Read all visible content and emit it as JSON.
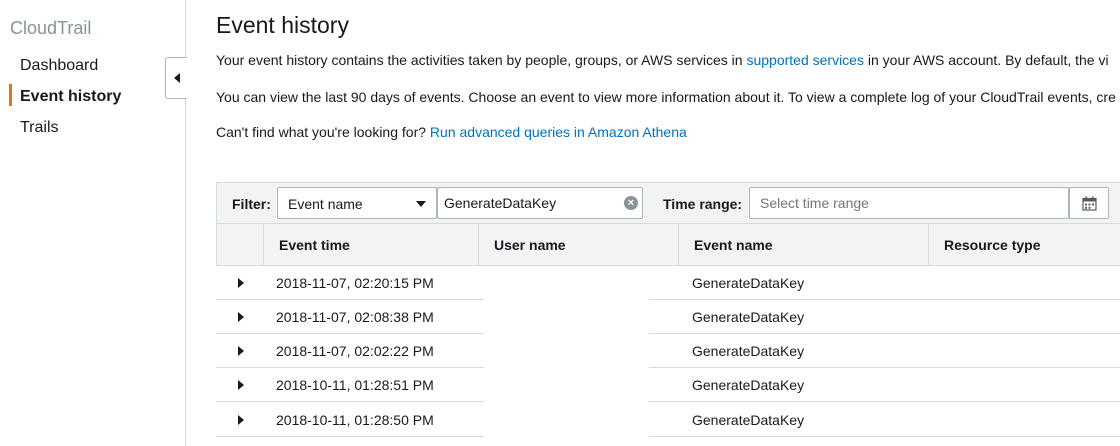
{
  "sidebar": {
    "title": "CloudTrail",
    "items": [
      {
        "label": "Dashboard",
        "active": false
      },
      {
        "label": "Event history",
        "active": true
      },
      {
        "label": "Trails",
        "active": false
      }
    ]
  },
  "main": {
    "title": "Event history",
    "intro_before_link": "Your event history contains the activities taken by people, groups, or AWS services in ",
    "intro_link": "supported services",
    "intro_after_link": " in your AWS account. By default, the vi",
    "view_text": "You can view the last 90 days of events. Choose an event to view more information about it. To view a complete log of your CloudTrail events, cre",
    "athena_prefix": "Can't find what you're looking for? ",
    "athena_link": "Run advanced queries in Amazon Athena"
  },
  "filter": {
    "label": "Filter:",
    "attribute": "Event name",
    "value": "GenerateDataKey",
    "time_label": "Time range:",
    "time_placeholder": "Select time range"
  },
  "table": {
    "columns": [
      "Event time",
      "User name",
      "Event name",
      "Resource type"
    ],
    "rows": [
      {
        "event_time": "2018-11-07, 02:20:15 PM",
        "user_name": "",
        "event_name": "GenerateDataKey",
        "resource_type": ""
      },
      {
        "event_time": "2018-11-07, 02:08:38 PM",
        "user_name": "",
        "event_name": "GenerateDataKey",
        "resource_type": ""
      },
      {
        "event_time": "2018-11-07, 02:02:22 PM",
        "user_name": "",
        "event_name": "GenerateDataKey",
        "resource_type": ""
      },
      {
        "event_time": "2018-10-11, 01:28:51 PM",
        "user_name": "",
        "event_name": "GenerateDataKey",
        "resource_type": ""
      },
      {
        "event_time": "2018-10-11, 01:28:50 PM",
        "user_name": "",
        "event_name": "GenerateDataKey",
        "resource_type": ""
      }
    ]
  },
  "colors": {
    "accent": "#ec7211",
    "link": "#0073bb"
  }
}
